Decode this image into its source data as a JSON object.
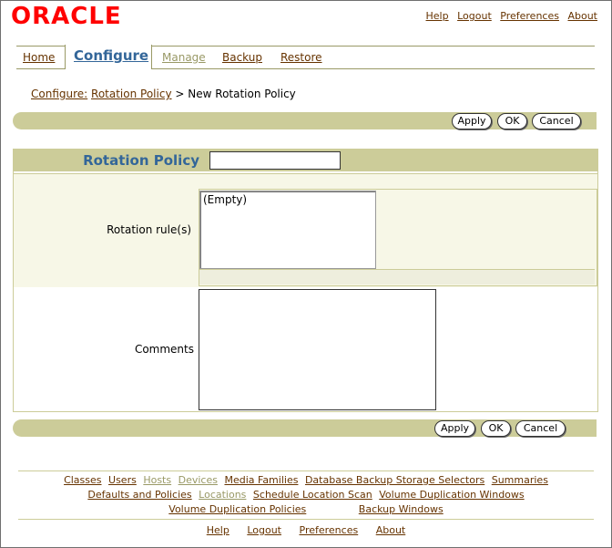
{
  "branding": {
    "logo_text": "ORACLE"
  },
  "global_links": [
    "Help",
    "Logout",
    "Preferences",
    "About"
  ],
  "tabs": [
    {
      "label": "Home",
      "state": "normal"
    },
    {
      "label": "Configure",
      "state": "active"
    },
    {
      "label": "Manage",
      "state": "disabled"
    },
    {
      "label": "Backup",
      "state": "normal"
    },
    {
      "label": "Restore",
      "state": "normal"
    }
  ],
  "breadcrumb": {
    "root": "Configure:",
    "parent": "Rotation Policy",
    "separator": ">",
    "current": "New Rotation Policy"
  },
  "buttons": {
    "apply": "Apply",
    "ok": "OK",
    "cancel": "Cancel"
  },
  "form": {
    "policy_label": "Rotation Policy",
    "policy_value": "",
    "rules_label": "Rotation rule(s)",
    "rules_items": [
      "(Empty)"
    ],
    "comments_label": "Comments",
    "comments_value": ""
  },
  "footer": {
    "row1": [
      {
        "label": "Classes",
        "state": "normal"
      },
      {
        "label": "Users",
        "state": "normal"
      },
      {
        "label": "Hosts",
        "state": "disabled"
      },
      {
        "label": "Devices",
        "state": "disabled"
      },
      {
        "label": "Media Families",
        "state": "normal"
      },
      {
        "label": "Database Backup Storage Selectors",
        "state": "normal"
      },
      {
        "label": "Summaries",
        "state": "normal"
      }
    ],
    "row2": [
      {
        "label": "Defaults and Policies",
        "state": "normal"
      },
      {
        "label": "Locations",
        "state": "disabled"
      },
      {
        "label": "Schedule Location Scan",
        "state": "normal"
      },
      {
        "label": "Volume Duplication Windows",
        "state": "normal"
      }
    ],
    "row3": [
      {
        "label": "Volume Duplication Policies",
        "state": "normal"
      },
      {
        "label": "Backup Windows",
        "state": "normal"
      }
    ],
    "bottom_links": [
      "Help",
      "Logout",
      "Preferences",
      "About"
    ]
  },
  "colors": {
    "brand_red": "#ff0000",
    "link": "#663300",
    "accent_blue": "#336699",
    "band": "#cccc99",
    "disabled": "#999966"
  }
}
